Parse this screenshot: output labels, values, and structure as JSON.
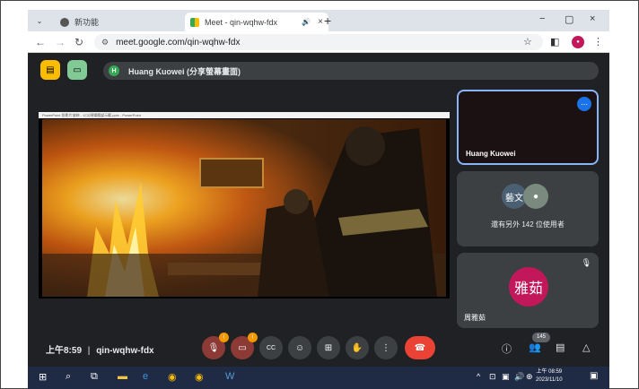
{
  "tabs": [
    {
      "title": "新功能",
      "close": "×"
    },
    {
      "title": "Meet - qin-wqhw-fdx",
      "audio": "🔊",
      "close": "×"
    }
  ],
  "new_tab": "+",
  "window_controls": [
    "−",
    "▢",
    "×"
  ],
  "address": {
    "url": "meet.google.com/qin-wqhw-fdx"
  },
  "presenter_bar": {
    "initial": "H",
    "label": "Huang Kuowei (分享螢幕畫面)"
  },
  "presentation": {
    "app_titlebar": "PowerPoint 投影片放映 - 火災現場應變示範.pptx - PowerPoint"
  },
  "tiles": [
    {
      "name": "Huang Kuowei",
      "more": "⋯"
    },
    {
      "avatar_text": "藝文",
      "others_text": "還有另外 142 位使用者"
    },
    {
      "avatar_text": "雅茹",
      "name": "周雅茹",
      "mic": "🎙"
    }
  ],
  "meeting": {
    "time": "上午8:59",
    "separator": "|",
    "code": "qin-wqhw-fdx"
  },
  "badges": {
    "mic": "!",
    "cam": "!"
  },
  "people_count": "145",
  "taskbar_clock": {
    "time": "上午 08:59",
    "date": "2023/11/10"
  },
  "tray_icons": [
    "^",
    "⊡",
    "▣",
    "🔊",
    "⊕"
  ],
  "colors": {
    "accent": "#1a73e8",
    "leave": "#ea4335",
    "tab_bg": "#dee3ea",
    "meet_bg": "#202124"
  }
}
